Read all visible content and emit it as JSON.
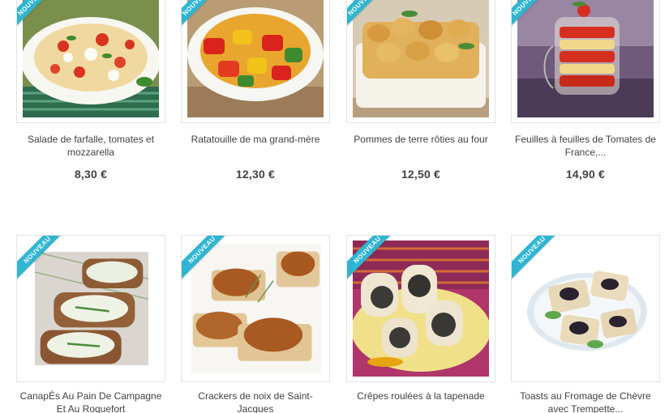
{
  "badge_label": "NOUVEAU",
  "accent_color": "#2fb5d2",
  "products": [
    {
      "title": "Salade de farfalle, tomates et mozzarella",
      "price": "8,30 €"
    },
    {
      "title": "Ratatouille de ma grand-mère",
      "price": "12,30 €"
    },
    {
      "title": "Pommes de terre rôties au four",
      "price": "12,50 €"
    },
    {
      "title": "Feuilles à feuilles de Tomates de France,...",
      "price": "14,90 €"
    },
    {
      "title": "CanapÉs Au Pain De Campagne Et Au Roquefort",
      "price": ""
    },
    {
      "title": "Crackers de noix de Saint-Jacques",
      "price": ""
    },
    {
      "title": "Crêpes roulées à la tapenade",
      "price": ""
    },
    {
      "title": "Toasts au Fromage de Chèvre avec Trempette...",
      "price": ""
    }
  ]
}
